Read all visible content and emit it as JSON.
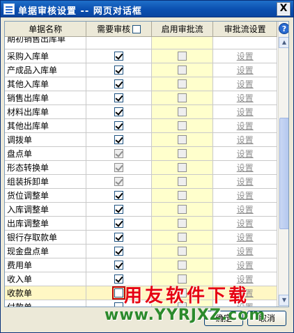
{
  "window": {
    "title": "单据审核设置 -- 网页对话框",
    "close_label": "X"
  },
  "table": {
    "headers": {
      "name": "单据名称",
      "need_review": "需要审核",
      "enable_flow": "启用审批流",
      "flow_setting": "审批流设置"
    },
    "header_checkbox_checked": false,
    "partial_row_name": "期初销售出库单",
    "rows": [
      {
        "name": "采购入库单",
        "review": true,
        "grey": false,
        "flow": false,
        "link": "设置"
      },
      {
        "name": "产成品入库单",
        "review": true,
        "grey": false,
        "flow": false,
        "link": "设置"
      },
      {
        "name": "其他入库单",
        "review": true,
        "grey": false,
        "flow": false,
        "link": "设置"
      },
      {
        "name": "销售出库单",
        "review": true,
        "grey": false,
        "flow": false,
        "link": "设置"
      },
      {
        "name": "材料出库单",
        "review": true,
        "grey": false,
        "flow": false,
        "link": "设置"
      },
      {
        "name": "其他出库单",
        "review": true,
        "grey": false,
        "flow": false,
        "link": "设置"
      },
      {
        "name": "调拨单",
        "review": true,
        "grey": false,
        "flow": false,
        "link": "设置"
      },
      {
        "name": "盘点单",
        "review": true,
        "grey": true,
        "flow": false,
        "link": "设置"
      },
      {
        "name": "形态转换单",
        "review": true,
        "grey": true,
        "flow": false,
        "link": "设置"
      },
      {
        "name": "组装拆卸单",
        "review": true,
        "grey": true,
        "flow": false,
        "link": "设置"
      },
      {
        "name": "货位调整单",
        "review": true,
        "grey": false,
        "flow": false,
        "link": "设置"
      },
      {
        "name": "入库调整单",
        "review": true,
        "grey": false,
        "flow": false,
        "link": "设置"
      },
      {
        "name": "出库调整单",
        "review": true,
        "grey": false,
        "flow": false,
        "link": "设置"
      },
      {
        "name": "银行存取款单",
        "review": true,
        "grey": false,
        "flow": false,
        "link": "设置"
      },
      {
        "name": "现金盘点单",
        "review": true,
        "grey": false,
        "flow": false,
        "link": "设置"
      },
      {
        "name": "费用单",
        "review": true,
        "grey": false,
        "flow": false,
        "link": "设置"
      },
      {
        "name": "收入单",
        "review": true,
        "grey": false,
        "flow": false,
        "link": "设置"
      },
      {
        "name": "收款单",
        "review": false,
        "grey": false,
        "flow": false,
        "link": "设置",
        "selected": true,
        "focused": true
      },
      {
        "name": "付款单",
        "review": false,
        "grey": false,
        "flow": false,
        "link": "设置"
      }
    ]
  },
  "buttons": {
    "ok": "确定",
    "cancel": "取消"
  },
  "scrollbar": {
    "up_icon": "arrow-up-icon",
    "down_icon": "arrow-down-icon",
    "help_icon": "help-icon",
    "help_label": "?",
    "up_glyph": "▲",
    "down_glyph": "▼"
  },
  "watermark": {
    "top": "用友软件下载",
    "bottom": "www.YYRJXZ.com"
  },
  "colors": {
    "titlebar": "#0b4fb0",
    "flow_column": "#ffffcc",
    "selected_row": "#fff7c4",
    "link_grey": "#8e8e8e",
    "watermark_red": "#e60012",
    "watermark_green": "#2c8a2c"
  }
}
